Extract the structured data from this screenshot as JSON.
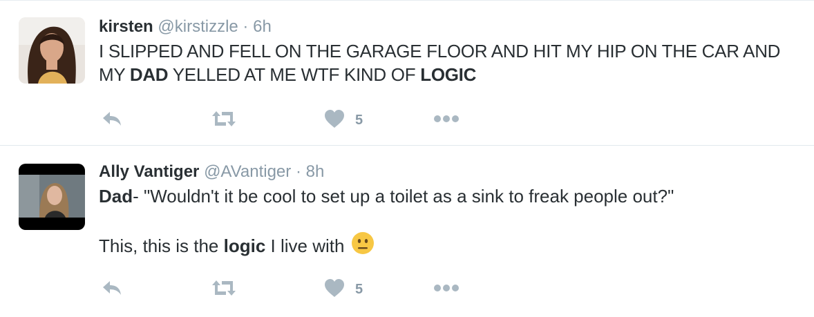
{
  "colors": {
    "action_gray": "#aab8c2",
    "meta_gray": "#8899a6",
    "text": "#292f33",
    "divider": "#e6ecf0"
  },
  "tweets": [
    {
      "name": "kirsten",
      "handle": "@kirstizzle",
      "separator": "·",
      "time": "6h",
      "text_parts": [
        "I SLIPPED AND FELL ON THE GARAGE FLOOR AND HIT MY HIP ON THE CAR AND MY ",
        "DAD",
        " YELLED AT ME WTF KIND OF ",
        "LOGIC"
      ],
      "like_count": "5",
      "icons": [
        "reply-icon",
        "retweet-icon",
        "heart-icon",
        "more-icon"
      ]
    },
    {
      "name": "Ally Vantiger",
      "handle": "@AVantiger",
      "separator": "·",
      "time": "8h",
      "line1_parts": [
        "Dad",
        "- \"Wouldn't it be cool to set up a toilet as a sink to freak people out?\""
      ],
      "line2_parts": [
        "This, this is the ",
        "logic",
        " I live with"
      ],
      "emoji": "neutral-face-emoji",
      "like_count": "5",
      "icons": [
        "reply-icon",
        "retweet-icon",
        "heart-icon",
        "more-icon"
      ]
    }
  ]
}
